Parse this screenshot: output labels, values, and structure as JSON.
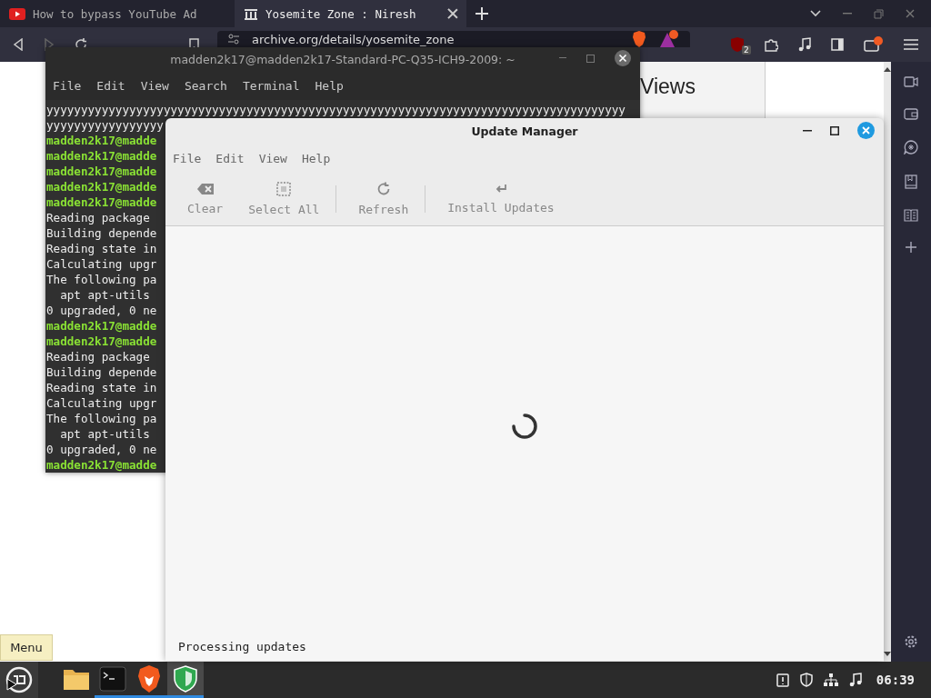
{
  "browser": {
    "tabs": [
      {
        "title": "How to bypass YouTube Ad",
        "selected": false
      },
      {
        "title": "Yosemite Zone : Niresh",
        "selected": true
      }
    ],
    "address": "archive.org/details/yosemite_zone",
    "blocked_count": "2",
    "page": {
      "heading": "Views"
    }
  },
  "terminal": {
    "title": "madden2k17@madden2k17-Standard-PC-Q35-ICH9-2009: ~",
    "menus": [
      "File",
      "Edit",
      "View",
      "Search",
      "Terminal",
      "Help"
    ],
    "lines": [
      {
        "text": "yyyyyyyyyyyyyyyyyyyyyyyyyyyyyyyyyyyyyyyyyyyyyyyyyyyyyyyyyyyyyyyyyyyyyyyyyyyyyyyyyyyy",
        "kind": "output"
      },
      {
        "text": "yyyyyyyyyyyyyyyyy",
        "kind": "output"
      },
      {
        "text": "madden2k17@madde",
        "kind": "prompt"
      },
      {
        "text": "madden2k17@madde",
        "kind": "prompt"
      },
      {
        "text": "madden2k17@madde",
        "kind": "prompt"
      },
      {
        "text": "madden2k17@madde",
        "kind": "prompt"
      },
      {
        "text": "madden2k17@madde",
        "kind": "prompt"
      },
      {
        "text": "Reading package",
        "kind": "output"
      },
      {
        "text": "Building depende",
        "kind": "output"
      },
      {
        "text": "Reading state in",
        "kind": "output"
      },
      {
        "text": "Calculating upgr",
        "kind": "output"
      },
      {
        "text": "The following pa",
        "kind": "output"
      },
      {
        "text": "  apt apt-utils",
        "kind": "output"
      },
      {
        "text": "0 upgraded, 0 ne",
        "kind": "output"
      },
      {
        "text": "madden2k17@madde",
        "kind": "prompt"
      },
      {
        "text": "madden2k17@madde",
        "kind": "prompt"
      },
      {
        "text": "Reading package",
        "kind": "output"
      },
      {
        "text": "Building depende",
        "kind": "output"
      },
      {
        "text": "Reading state in",
        "kind": "output"
      },
      {
        "text": "Calculating upgr",
        "kind": "output"
      },
      {
        "text": "The following pa",
        "kind": "output"
      },
      {
        "text": "  apt apt-utils",
        "kind": "output"
      },
      {
        "text": "0 upgraded, 0 ne",
        "kind": "output"
      },
      {
        "text": "madden2k17@madde",
        "kind": "prompt"
      }
    ]
  },
  "update_manager": {
    "title": "Update Manager",
    "menus": [
      "File",
      "Edit",
      "View",
      "Help"
    ],
    "toolbar": [
      {
        "label": "Clear",
        "disabled": true
      },
      {
        "label": "Select All",
        "disabled": true
      },
      {
        "label": "Refresh",
        "disabled": true
      },
      {
        "label": "Install Updates",
        "disabled": true
      }
    ],
    "status": "Processing updates"
  },
  "tooltip": "Menu",
  "taskbar": {
    "apps": [
      {
        "running": false,
        "selected": false
      },
      {
        "running": true,
        "selected": false
      },
      {
        "running": true,
        "selected": false
      },
      {
        "running": true,
        "selected": true
      }
    ],
    "clock": "06:39"
  }
}
